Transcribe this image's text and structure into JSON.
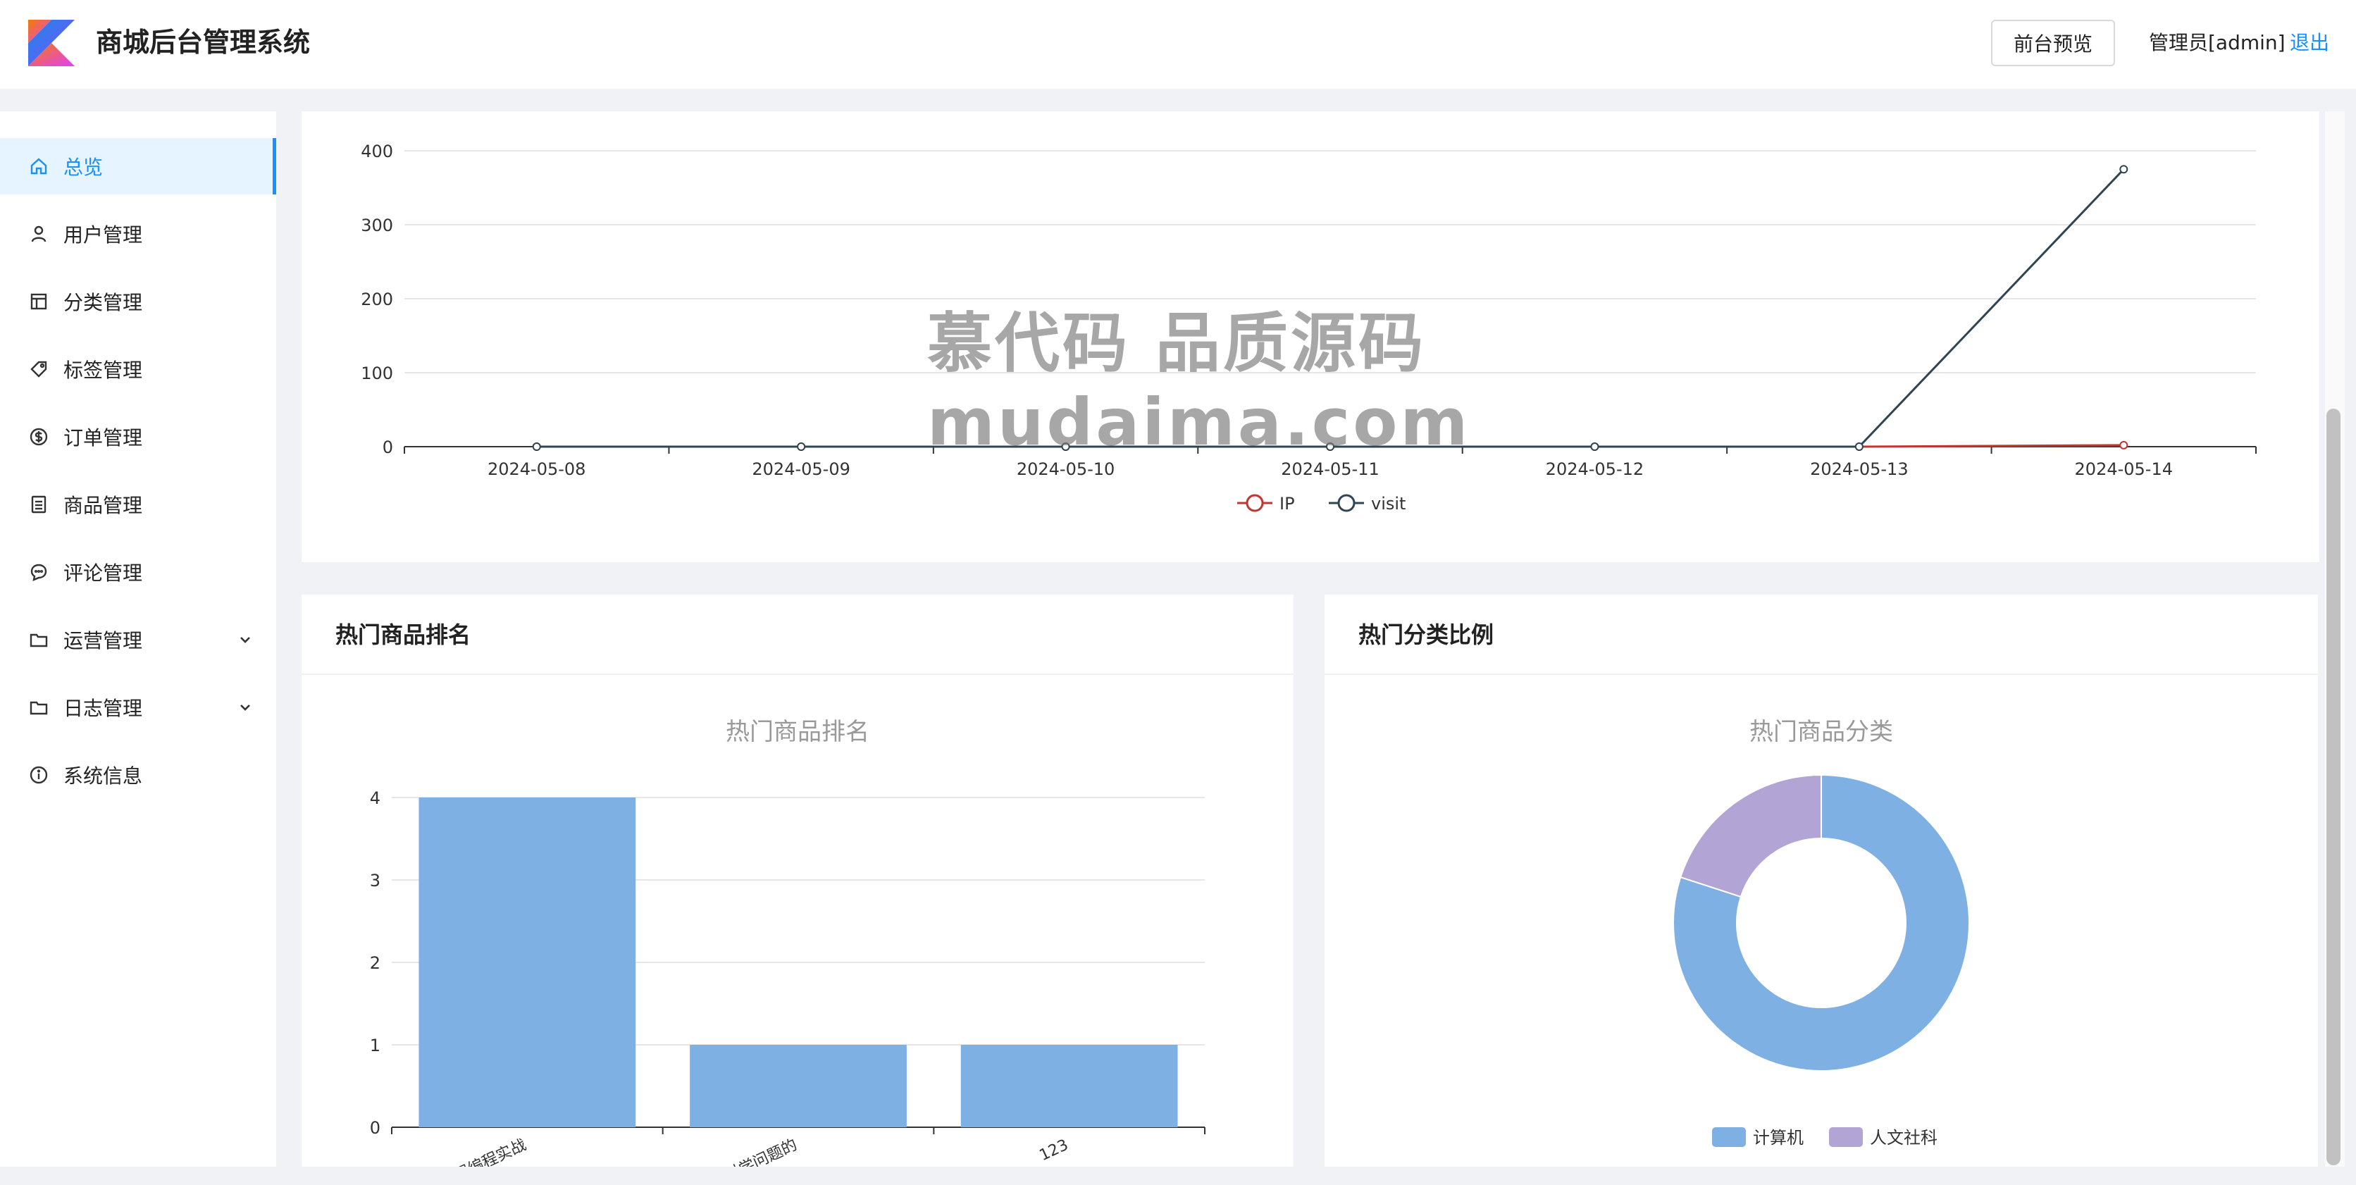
{
  "header": {
    "app_title": "商城后台管理系统",
    "preview_button": "前台预览",
    "admin_label": "管理员[admin]",
    "logout_link": "退出"
  },
  "sidebar": {
    "items": [
      {
        "label": "总览",
        "icon": "home-icon",
        "active": true
      },
      {
        "label": "用户管理",
        "icon": "user-icon"
      },
      {
        "label": "分类管理",
        "icon": "layout-icon"
      },
      {
        "label": "标签管理",
        "icon": "tag-icon"
      },
      {
        "label": "订单管理",
        "icon": "dollar-icon"
      },
      {
        "label": "商品管理",
        "icon": "list-icon"
      },
      {
        "label": "评论管理",
        "icon": "comment-icon"
      },
      {
        "label": "运营管理",
        "icon": "folder-icon",
        "expandable": true
      },
      {
        "label": "日志管理",
        "icon": "folder-icon",
        "expandable": true
      },
      {
        "label": "系统信息",
        "icon": "info-icon"
      }
    ]
  },
  "panels": {
    "hot_products_title": "热门商品排名",
    "hot_categories_title": "热门分类比例"
  },
  "watermark": {
    "line1": "慕代码 品质源码",
    "line2": "mudaima.com"
  },
  "colors": {
    "accent": "#1890ff",
    "ip_series": "#c23531",
    "visit_series": "#2f4554",
    "bar": "#7eb0e4",
    "pie_purple": "#b3a4d6"
  },
  "chart_data": [
    {
      "type": "line",
      "x": [
        "2024-05-08",
        "2024-05-09",
        "2024-05-10",
        "2024-05-11",
        "2024-05-12",
        "2024-05-13",
        "2024-05-14"
      ],
      "series": [
        {
          "name": "IP",
          "values": [
            0,
            0,
            0,
            0,
            0,
            0,
            2
          ]
        },
        {
          "name": "visit",
          "values": [
            0,
            0,
            0,
            0,
            0,
            0,
            375
          ]
        }
      ],
      "yticks": [
        "0",
        "100",
        "200",
        "300",
        "400"
      ],
      "ylim": [
        0,
        400
      ],
      "legend_position": "bottom-center",
      "grid": true
    },
    {
      "type": "bar",
      "title": "热门商品排名",
      "categories": [
        "并发编程实战",
        "的科学问题的",
        "123"
      ],
      "category_labels": [
        "发程编程实战",
        "的科学问题的",
        "123"
      ],
      "values": [
        4,
        1,
        1
      ],
      "yticks": [
        "0",
        "1",
        "2",
        "3",
        "4"
      ],
      "ylim": [
        0,
        4
      ],
      "grid": true
    },
    {
      "type": "pie",
      "title": "热门商品分类",
      "slices": [
        {
          "name": "计算机",
          "value": 4
        },
        {
          "name": "人文社科",
          "value": 1
        }
      ],
      "donut": true,
      "legend_position": "bottom-center"
    }
  ]
}
